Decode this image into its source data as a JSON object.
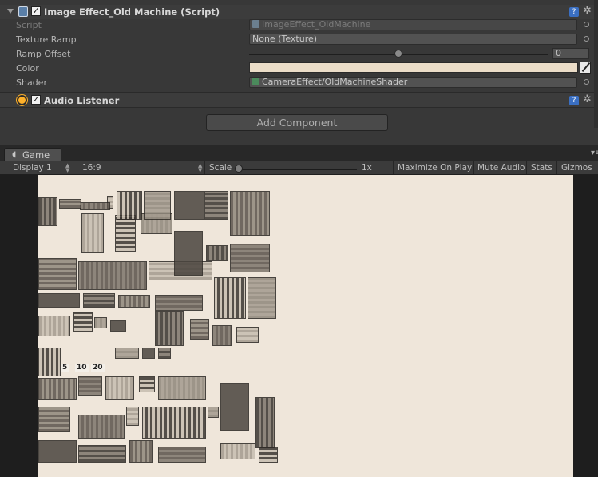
{
  "inspector": {
    "old_machine": {
      "title": "Image Effect_Old Machine (Script)",
      "enabled": true,
      "properties": {
        "script": {
          "label": "Script",
          "value": "ImageEffect_OldMachine"
        },
        "texture_ramp": {
          "label": "Texture Ramp",
          "value": "None (Texture)"
        },
        "ramp_offset": {
          "label": "Ramp Offset",
          "value": "0"
        },
        "color": {
          "label": "Color",
          "value": "#ebddc8"
        },
        "shader": {
          "label": "Shader",
          "value": "CameraEffect/OldMachineShader"
        }
      }
    },
    "audio_listener": {
      "title": "Audio Listener",
      "enabled": true
    },
    "add_component_label": "Add Component",
    "check_glyph": "✓",
    "help_glyph": "?",
    "gear_glyph": "✲"
  },
  "game": {
    "tab_label": "Game",
    "tab_icon": "pac-icon",
    "toolbar": {
      "display": "Display 1",
      "aspect": "16:9",
      "scale_label": "Scale",
      "scale_value": "1x",
      "maximize": "Maximize On Play",
      "mute": "Mute Audio",
      "stats": "Stats",
      "gizmos": "Gizmos"
    },
    "sprite_labels": [
      "5",
      "10",
      "20"
    ]
  },
  "colors": {
    "panel": "#383838",
    "game_background": "#efe6da",
    "sepia_tint": "#ebddc8",
    "accent": "#3a6fc2"
  }
}
